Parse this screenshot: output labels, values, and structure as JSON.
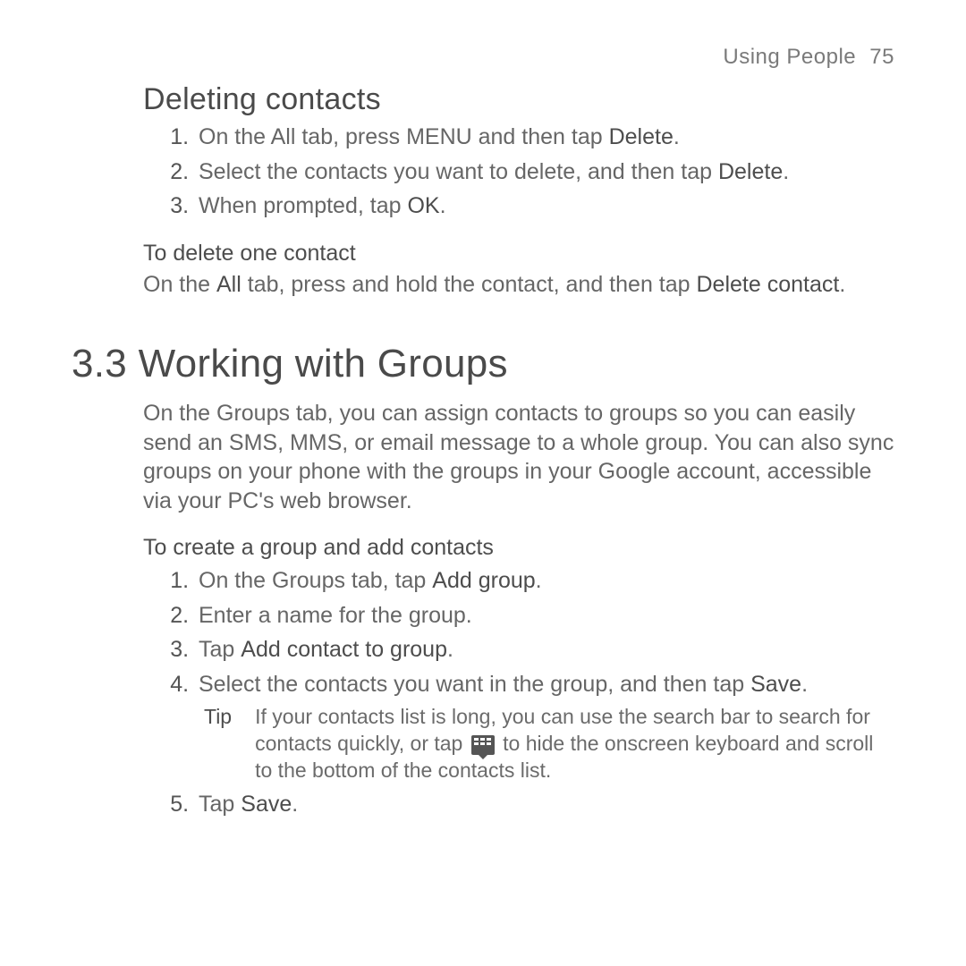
{
  "header": {
    "section": "Using People",
    "page": "75"
  },
  "deleting": {
    "title": "Deleting contacts",
    "steps": [
      {
        "pre": "On the All tab, press MENU and then tap ",
        "bold": "Delete",
        "post": "."
      },
      {
        "pre": "Select the contacts you want to delete, and then tap ",
        "bold": "Delete",
        "post": "."
      },
      {
        "pre": "When prompted, tap ",
        "bold": "OK",
        "post": "."
      }
    ],
    "sub_title": "To delete one contact",
    "sub_body_1": "On the ",
    "sub_bold_1": "All",
    "sub_body_2": " tab, press and hold the contact, and then tap ",
    "sub_bold_2": "Delete contact",
    "sub_body_3": "."
  },
  "groups": {
    "title": "3.3  Working with Groups",
    "intro": "On the Groups tab, you can assign contacts to groups so you can easily send an SMS, MMS, or email message to a whole group. You can also sync groups on your phone with the groups in your Google account, accessible via your PC's web browser.",
    "sub_title": "To create a group and add contacts",
    "steps": [
      {
        "pre": "On the Groups tab, tap ",
        "bold": "Add group",
        "post": "."
      },
      {
        "pre": "Enter a name for the group.",
        "bold": "",
        "post": ""
      },
      {
        "pre": "Tap ",
        "bold": "Add contact to group",
        "post": "."
      },
      {
        "pre": "Select the contacts you want in the group, and then tap ",
        "bold": "Save",
        "post": "."
      },
      {
        "pre": "Tap ",
        "bold": "Save",
        "post": "."
      }
    ],
    "tip_label": "Tip",
    "tip_pre": "If your contacts list is long, you can use the search bar to search for contacts quickly, or tap ",
    "tip_post": " to hide the onscreen keyboard and scroll to the bottom of the contacts list."
  }
}
